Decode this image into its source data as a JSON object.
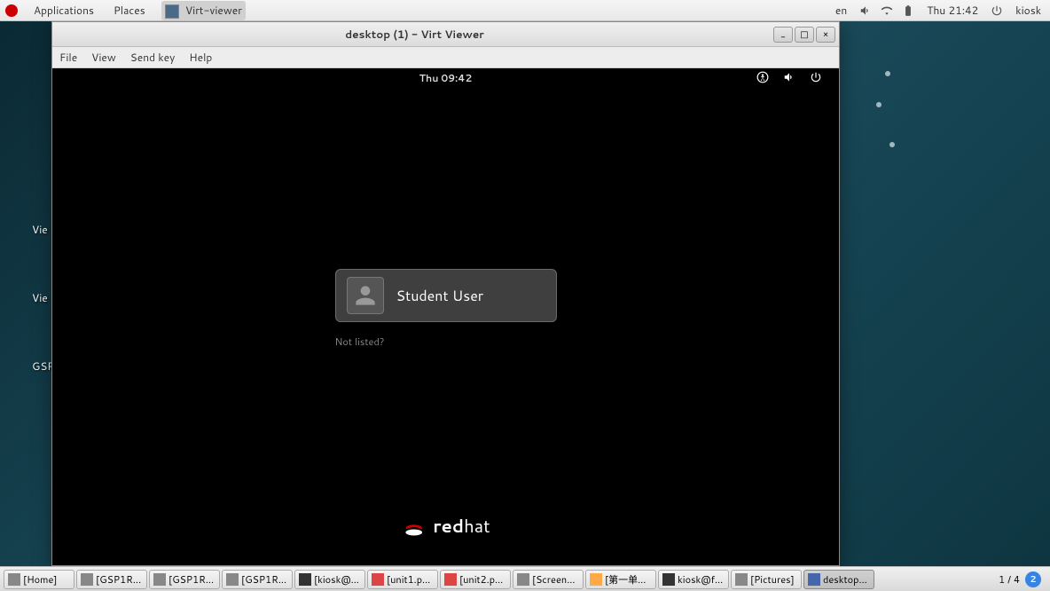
{
  "top_panel": {
    "applications": "Applications",
    "places": "Places",
    "active_app": "Virt-viewer",
    "lang": "en",
    "datetime": "Thu 21:42",
    "user": "kiosk"
  },
  "desktop_icons": {
    "label1": "Vie",
    "label2": "Vie",
    "label3": "GSP"
  },
  "window": {
    "title": "desktop (1) - Virt Viewer",
    "menus": {
      "file": "File",
      "view": "View",
      "sendkey": "Send key",
      "help": "Help"
    }
  },
  "guest": {
    "time": "Thu 09:42",
    "user_name": "Student User",
    "not_listed": "Not listed?",
    "brand_bold": "red",
    "brand_light": "hat"
  },
  "taskbar": {
    "items": [
      {
        "label": "[Home]"
      },
      {
        "label": "[GSP1R..."
      },
      {
        "label": "[GSP1R..."
      },
      {
        "label": "[GSP1R..."
      },
      {
        "label": "[kiosk@..."
      },
      {
        "label": "[unit1.p..."
      },
      {
        "label": "[unit2.p..."
      },
      {
        "label": "[Screen..."
      },
      {
        "label": "[第一单..."
      },
      {
        "label": "kiosk@f..."
      },
      {
        "label": "[Pictures]"
      },
      {
        "label": "desktop..."
      }
    ],
    "workspace": "1 / 4",
    "ws_badge": "2"
  }
}
